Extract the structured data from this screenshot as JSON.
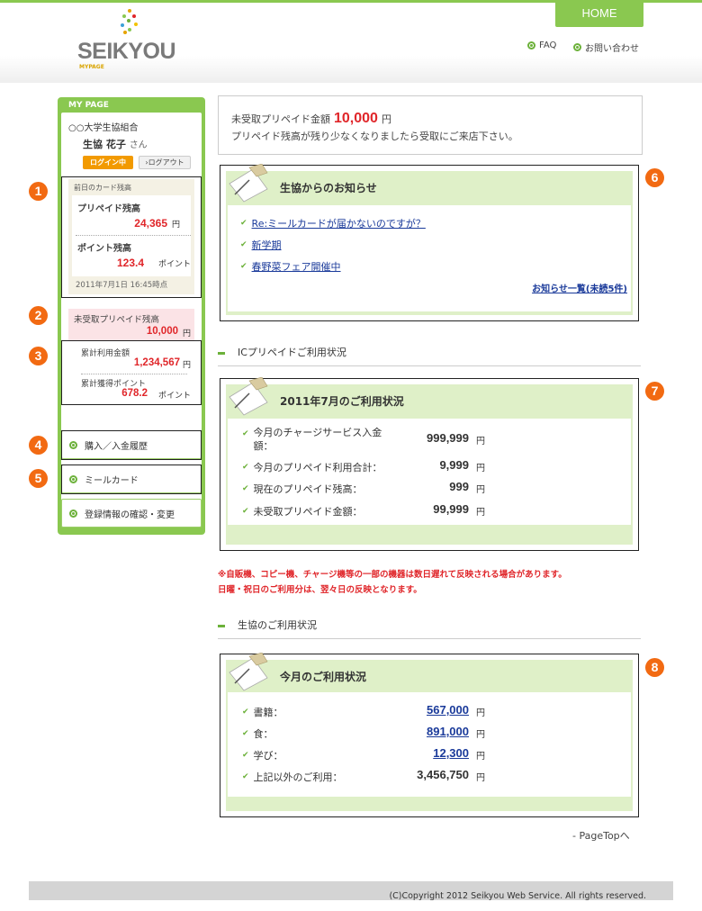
{
  "header": {
    "logo_text": "SEIKYOU",
    "logo_sub": "MYPAGE",
    "home_label": "HOME",
    "faq_label": "FAQ",
    "contact_label": "お問い合わせ"
  },
  "sidebar": {
    "title": "MY PAGE",
    "org": "○○大学生協組合",
    "user_name": "生協 花子",
    "user_suffix": "さん",
    "login_status": "ログイン中",
    "logout_label": "›ログアウト",
    "balance_header": "前日のカード残高",
    "prepaid_label": "プリペイド残高",
    "prepaid_value": "24,365",
    "prepaid_unit": "円",
    "point_label": "ポイント残高",
    "point_value": "123.4",
    "point_unit": "ポイント",
    "timestamp": "2011年7月1日 16:45時点",
    "unreceived_label": "未受取プリペイド残高",
    "unreceived_value": "10,000",
    "unreceived_unit": "円",
    "total_use_label": "累計利用金額",
    "total_use_value": "1,234,567",
    "total_use_unit": "円",
    "total_point_label": "累計獲得ポイント",
    "total_point_value": "678.2",
    "total_point_unit": "ポイント",
    "menu": [
      "購入／入金履歴",
      "ミールカード",
      "登録情報の確認・変更"
    ]
  },
  "markers": [
    "1",
    "2",
    "3",
    "4",
    "5",
    "6",
    "7",
    "8"
  ],
  "notice_bar": {
    "label": "未受取プリペイド金額",
    "value": "10,000",
    "unit": "円",
    "message": "プリペイド残高が残り少なくなりましたら受取にご来店下さい。"
  },
  "news": {
    "title": "生協からのお知らせ",
    "items": [
      "Re:ミールカードが届かないのですが？",
      "新学期",
      "春野菜フェア開催中"
    ],
    "more_link": "お知らせ一覧(未読5件)"
  },
  "ic_section": {
    "heading": "ICプリペイドご利用状況",
    "card_title": "2011年7月のご利用状況",
    "rows": [
      {
        "label": "今月のチャージサービス入金",
        "label2": "額：",
        "value": "999,999",
        "unit": "円"
      },
      {
        "label": "今月のプリペイド利用合計：",
        "value": "9,999",
        "unit": "円"
      },
      {
        "label": "現在のプリペイド残高：",
        "value": "999",
        "unit": "円"
      },
      {
        "label": "未受取プリペイド金額：",
        "value": "99,999",
        "unit": "円"
      }
    ],
    "note_line1": "※自販機、コピー機、チャージ機等の一部の機器は数日遅れて反映される場合があります。",
    "note_line2": "日曜・祝日のご利用分は、翌々日の反映となります。"
  },
  "coop_section": {
    "heading": "生協のご利用状況",
    "card_title": "今月のご利用状況",
    "rows": [
      {
        "label": "書籍：",
        "value": "567,000",
        "unit": "円"
      },
      {
        "label": "食：",
        "value": "891,000",
        "unit": "円"
      },
      {
        "label": "学び：",
        "value": "12,300",
        "unit": "円"
      },
      {
        "label": "上記以外のご利用：",
        "value": "3,456,750",
        "unit": "円"
      }
    ]
  },
  "pagetop": "- PageTopへ",
  "footer": "(C)Copyright 2012 Seikyou Web Service. All rights reserved.",
  "colors": {
    "accent": "#8ac850",
    "marker": "#f26a12",
    "alert": "#e0262a",
    "link": "#1a3a9a"
  }
}
